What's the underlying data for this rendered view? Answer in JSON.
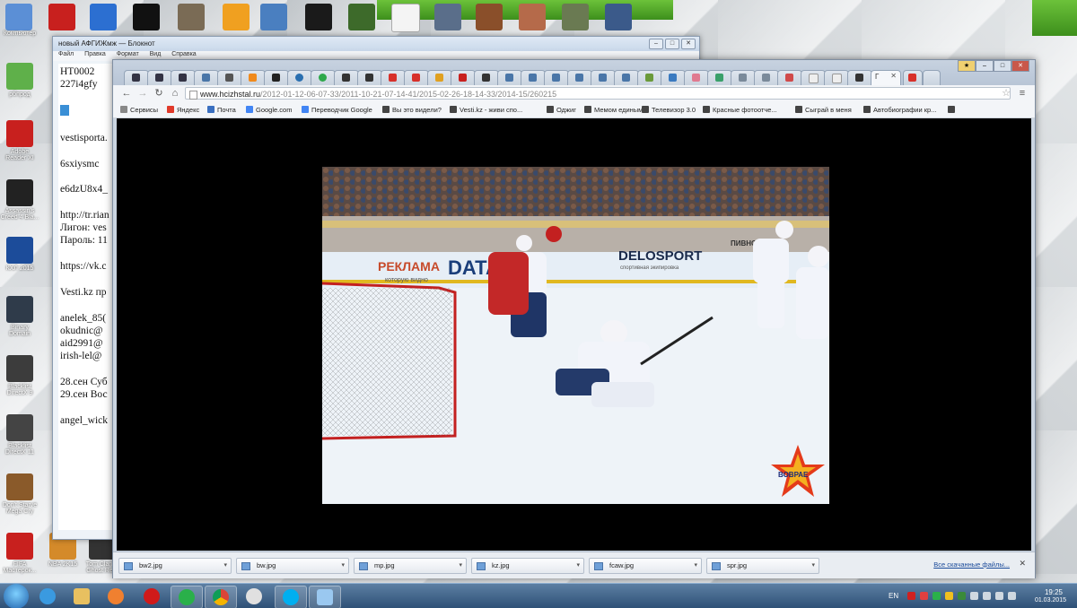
{
  "notepad": {
    "title": "новый АФГИЖмж — Блокнот",
    "menu": [
      "Файл",
      "Правка",
      "Формат",
      "Вид",
      "Справка"
    ],
    "lines": [
      "HT0002",
      "227i4gfy",
      "vestisporta.",
      "6sxiysmc",
      "e6dzU8x4_",
      "http://tr.rian",
      "Лигон: ves",
      "Пароль: 11",
      "https://vk.c",
      "Vesti.kz пр",
      "anelek_85(",
      "okudnic@",
      "aid2991@",
      "irish-lel@",
      "28.сен Суб",
      "29.сен Вос",
      "angel_wick"
    ]
  },
  "browser": {
    "active_tab_label": "Г",
    "url_host": "www.hcizhstal.ru",
    "url_path": "/2012-01-12-06-07-33/2011-10-21-07-14-41/2015-02-26-18-14-33/2014-15/260215",
    "bookmarks": [
      "Сервисы",
      "Яндекс",
      "Почта",
      "Google.com",
      "Переводчик Google",
      "Вы это видели?",
      "Vesti.kz - живи спо...",
      "Оджиг",
      "Мемом единым",
      "Телевизор 3.0",
      "Красные фотоотче...",
      "Сыграй в меня",
      "Автобиографии кр..."
    ],
    "downloads": [
      "bw2.jpg",
      "bw.jpg",
      "mp.jpg",
      "kz.jpg",
      "fcaw.jpg",
      "spr.jpg"
    ],
    "downloads_all": "Все скачанные файлы..."
  },
  "photo": {
    "sign_left": "РЕКЛАМА",
    "sign_sub": "которую видно",
    "sign_data": "DATAUN",
    "sign_delo": "DELOSPORT",
    "sign_delo_sub": "спортивная экипировка",
    "sign_beer": "ПИВНОЙ",
    "logo_text": "ВОВРАЕ"
  },
  "desktop": {
    "icons_left": [
      "Компьютер",
      "рбпрод",
      "Adobe Reader XI",
      "Assassin's Creed 4 Bla...",
      "КХЛ 2015",
      "Binary Domain",
      "Blacklist DirectX 9",
      "Blacklist DirectX 11",
      "Don't Starve Mega Cry",
      "FIFA Мастерок..."
    ],
    "icons_row2": [
      "NBA 2K15",
      "Tom Clancy Ghost Re..."
    ]
  },
  "taskbar": {
    "lang": "EN",
    "time": "19:25",
    "date": "01.03.2015"
  }
}
